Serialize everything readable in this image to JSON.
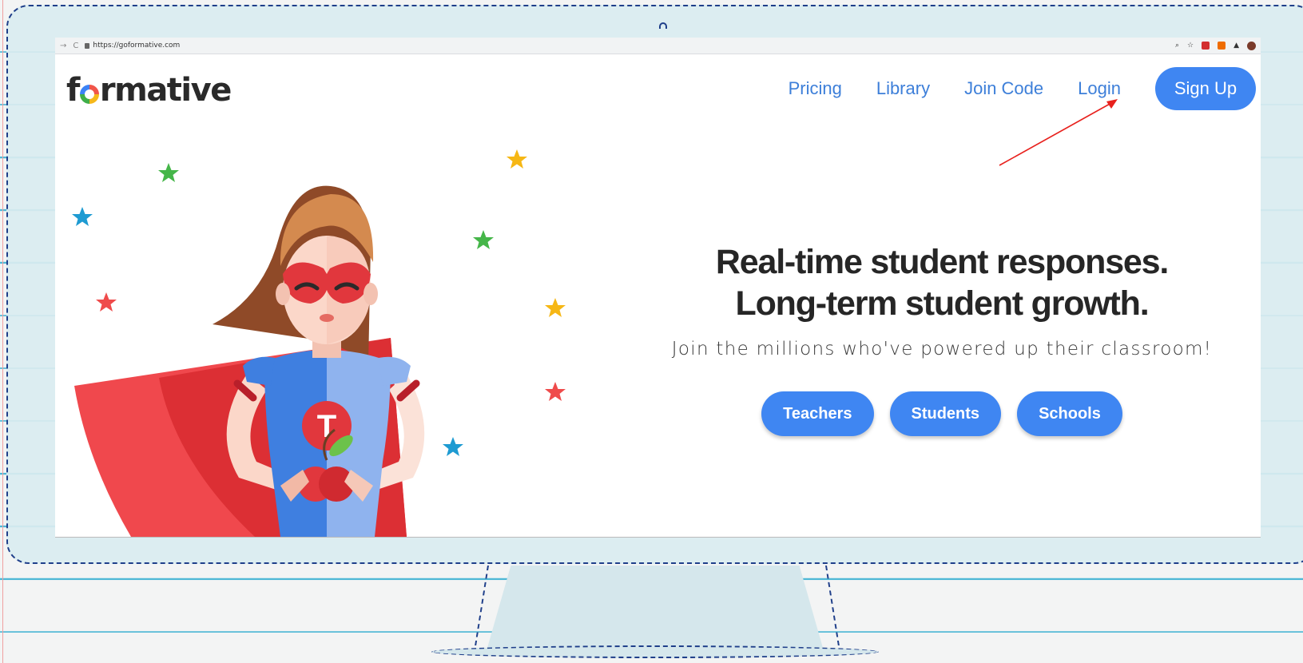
{
  "browser": {
    "url": "https://goformative.com"
  },
  "header": {
    "logo_left": "f",
    "logo_right": "rmative",
    "nav": {
      "pricing": "Pricing",
      "library": "Library",
      "join_code": "Join Code",
      "login": "Login"
    },
    "signup_label": "Sign Up"
  },
  "hero": {
    "headline_line1": "Real-time student responses.",
    "headline_line2": "Long-term student growth.",
    "subline": "Join the millions who've powered up their classroom!",
    "buttons": {
      "teachers": "Teachers",
      "students": "Students",
      "schools": "Schools"
    },
    "badge_letter": "T"
  },
  "colors": {
    "accent": "#3f86f2",
    "nav_link": "#3d7fd9",
    "annotation_arrow": "#e8211d",
    "cape": "#e1373d"
  }
}
